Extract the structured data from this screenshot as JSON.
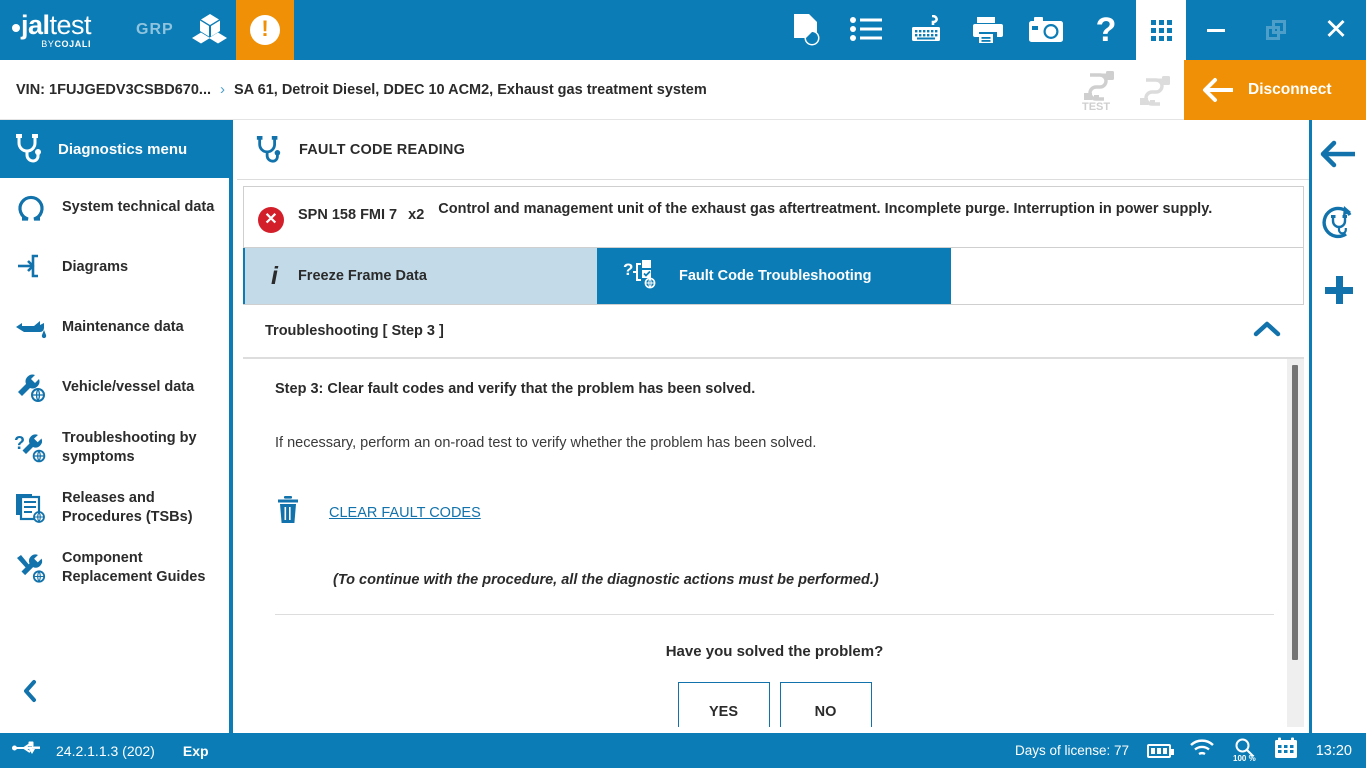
{
  "topbar": {
    "logo_main": "jaltest",
    "logo_sub": "BYCOJALI",
    "group_label": "GRP",
    "icons": [
      "cubes-icon",
      "warning-icon",
      "document-report-icon",
      "list-icon",
      "keyboard-icon",
      "printer-icon",
      "camera-icon",
      "help-icon",
      "apps-grid-icon"
    ],
    "help_glyph": "?",
    "warning_glyph": "!",
    "window": {
      "minimize": "minimize-button",
      "restore": "restore-button",
      "close": "close-button",
      "close_glyph": "✕"
    }
  },
  "breadcrumb": {
    "vin": "VIN: 1FUJGEDV3CSBD670...",
    "separator": "›",
    "system": "SA 61, Detroit Diesel, DDEC 10 ACM2, Exhaust gas treatment system",
    "connector_test_label": "TEST",
    "disconnect_label": "Disconnect"
  },
  "sidebar": {
    "header": "Diagnostics menu",
    "items": [
      {
        "label": "System technical data",
        "icon": "omega-icon"
      },
      {
        "label": "Diagrams",
        "icon": "diagram-arrow-icon"
      },
      {
        "label": "Maintenance data",
        "icon": "oil-can-icon"
      },
      {
        "label": "Vehicle/vessel data",
        "icon": "wrench-globe-icon"
      },
      {
        "label": "Troubleshooting by symptoms",
        "icon": "question-wrench-icon"
      },
      {
        "label": "Releases and Procedures (TSBs)",
        "icon": "documents-globe-icon"
      },
      {
        "label": "Component Replacement Guides",
        "icon": "tools-globe-icon"
      }
    ],
    "collapse": "chevron-left-icon"
  },
  "main": {
    "page_title": "FAULT CODE READING",
    "fault": {
      "code": "SPN 158 FMI 7",
      "count": "x2",
      "description": "Control and management unit of the exhaust gas aftertreatment. Incomplete purge. Interruption in power supply.",
      "status_color": "#d31f2a"
    },
    "tabs": [
      {
        "label": "Freeze Frame Data",
        "active": false,
        "icon": "info-icon"
      },
      {
        "label": "Fault Code Troubleshooting",
        "active": true,
        "icon": "fault-tree-icon"
      }
    ],
    "section": {
      "title": "Troubleshooting [ Step 3 ]",
      "collapse_icon": "chevron-up-icon"
    },
    "step": {
      "title": "Step 3: Clear fault codes and verify that the problem has been solved.",
      "note": "If necessary, perform an on-road test to verify whether the problem has been solved.",
      "action_link": "CLEAR FAULT CODES",
      "action_icon": "trash-icon",
      "procedure_note": "(To continue with the procedure, all the diagnostic actions must be performed.)",
      "question": "Have you solved the problem?",
      "yes_label": "YES",
      "no_label": "NO"
    }
  },
  "rail": {
    "back": "arrow-left-icon",
    "rescan": "refresh-diagnostics-icon",
    "add": "plus-icon"
  },
  "statusbar": {
    "usb_icon": "usb-icon",
    "version": "24.2.1.1.3 (202)",
    "mode": "Exp",
    "license": "Days of license: 77",
    "battery_icon": "battery-icon",
    "wifi_icon": "wifi-icon",
    "zoom": "100 %",
    "calendar_icon": "calendar-icon",
    "time": "13:20"
  },
  "theme": {
    "brand_blue": "#0b7cb5",
    "accent_orange": "#ef9007",
    "error_red": "#d31f2a",
    "link_blue": "#1272ab",
    "tab_inactive": "#c3dbe9"
  }
}
